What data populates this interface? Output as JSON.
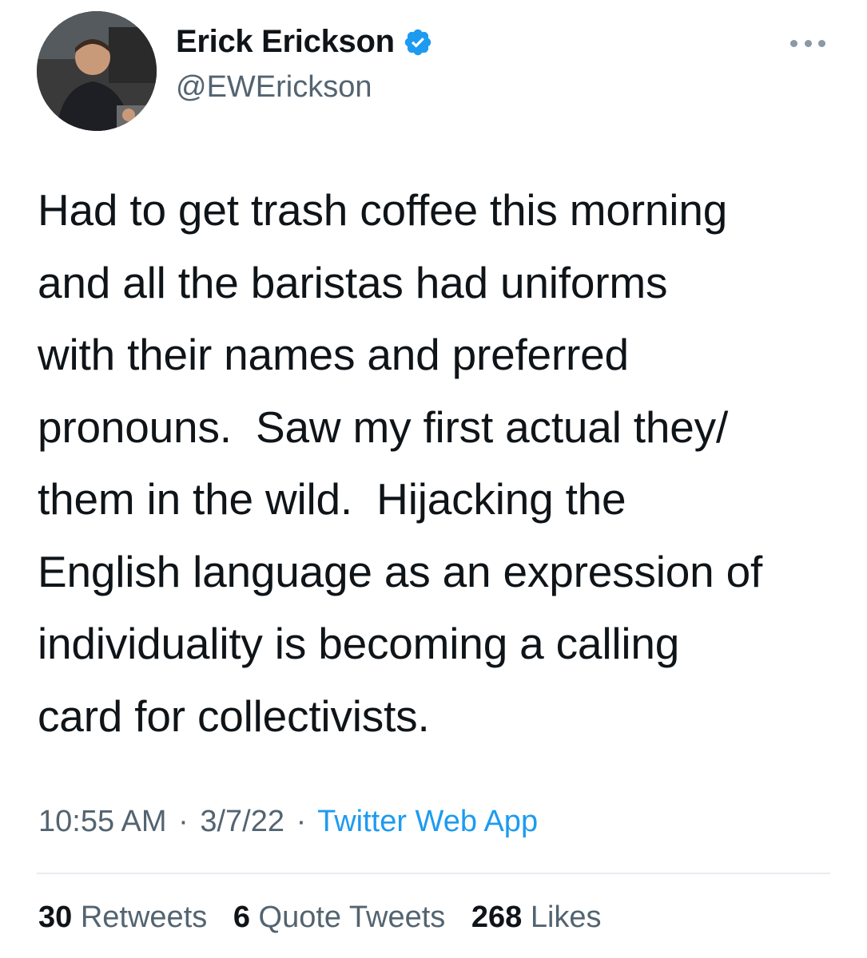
{
  "author": {
    "display_name": "Erick Erickson",
    "handle": "@EWErickson",
    "verified": true,
    "avatar_icon": "profile-photo"
  },
  "tweet": {
    "text": "Had to get trash coffee this morning\nand all the baristas had uniforms\nwith their names and preferred\npronouns.  Saw my first actual they/\nthem in the wild.  Hijacking the\nEnglish language as an expression of\nindividuality is becoming a calling\ncard for collectivists.",
    "time": "10:55 AM",
    "separator": "·",
    "date": "3/7/22",
    "source": "Twitter Web App"
  },
  "stats": {
    "retweets_count": "30",
    "retweets_label": "Retweets",
    "quote_count": "6",
    "quote_label": "Quote Tweets",
    "likes_count": "268",
    "likes_label": "Likes"
  },
  "colors": {
    "text": "#0f1419",
    "secondary": "#536471",
    "accent": "#1d9bf0",
    "divider": "#e6ecf0"
  }
}
